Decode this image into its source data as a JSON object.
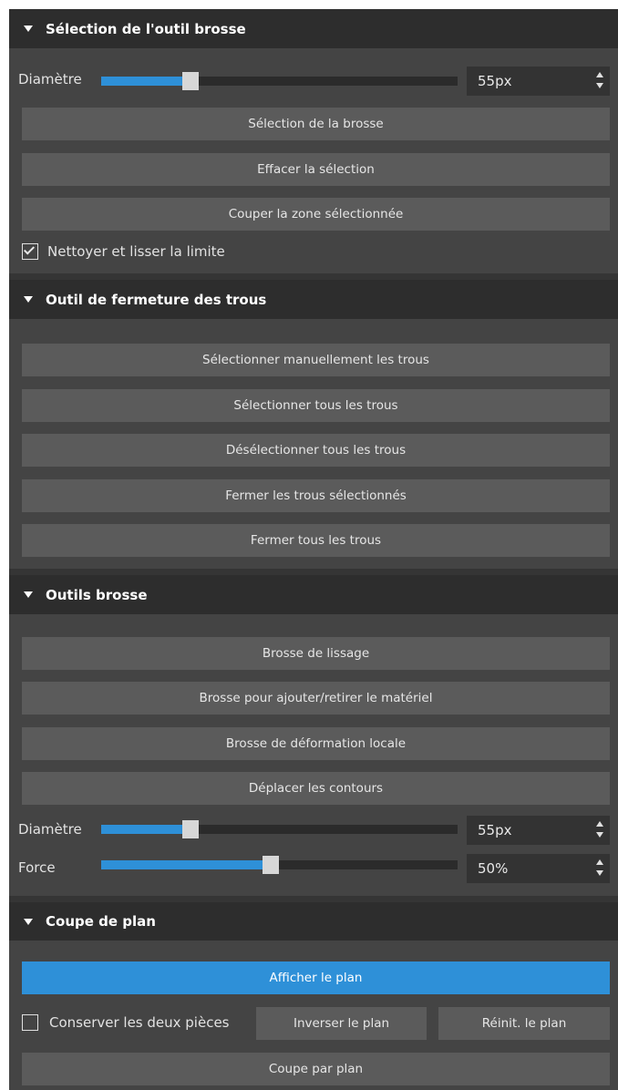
{
  "brush_selection": {
    "title": "Sélection de l'outil brosse",
    "diameter_label": "Diamètre",
    "diameter_value": "55px",
    "diameter_slider_fraction": 0.25,
    "buttons": [
      "Sélection de la brosse",
      "Effacer la sélection",
      "Couper la zone sélectionnée"
    ],
    "clean_checkbox_label": "Nettoyer et lisser la limite",
    "clean_checkbox_checked": true
  },
  "hole_closing": {
    "title": "Outil de fermeture des trous",
    "buttons": [
      "Sélectionner manuellement les trous",
      "Sélectionner tous les trous",
      "Désélectionner tous les trous",
      "Fermer les trous sélectionnés",
      "Fermer tous les trous"
    ]
  },
  "brush_tools": {
    "title": "Outils brosse",
    "buttons": [
      "Brosse de lissage",
      "Brosse pour ajouter/retirer le matériel",
      "Brosse de déformation locale",
      "Déplacer les contours"
    ],
    "diameter_label": "Diamètre",
    "diameter_value": "55px",
    "diameter_slider_fraction": 0.25,
    "force_label": "Force",
    "force_value": "50%",
    "force_slider_fraction": 0.5
  },
  "plane_cut": {
    "title": "Coupe de plan",
    "show_plane_label": "Afficher le plan",
    "keep_both_label": "Conserver les deux pièces",
    "keep_both_checked": false,
    "invert_plane_label": "Inverser le plan",
    "reset_plane_label": "Réinit. le plan",
    "cut_by_plane_label": "Coupe par plan"
  },
  "colors": {
    "accent": "#2e90d8",
    "panel": "#444444",
    "header": "#2d2d2d",
    "button": "#5b5b5b"
  }
}
